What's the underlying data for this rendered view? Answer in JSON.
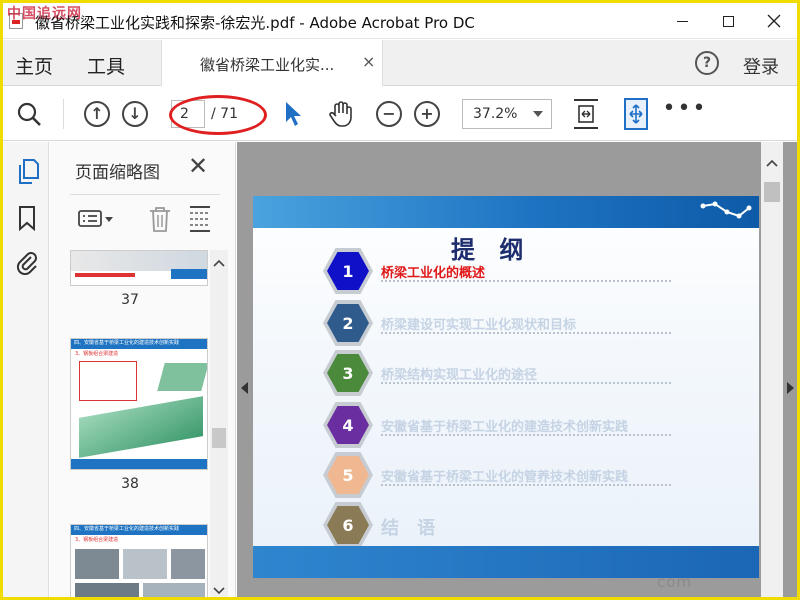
{
  "window": {
    "title": "徽省桥梁工业化实践和探索-徐宏光.pdf - Adobe Acrobat Pro DC",
    "watermark": "中国追远网"
  },
  "menubar": {
    "home": "主页",
    "tools": "工具",
    "tab_label": "徽省桥梁工业化实...",
    "tab_close": "×",
    "login": "登录"
  },
  "toolbar": {
    "current_page": "2",
    "total_pages": "/ 71",
    "zoom": "37.2%",
    "more": "•••"
  },
  "thumbnails": {
    "title": "页面缩略图",
    "close": "✕",
    "items": [
      {
        "page": "37"
      },
      {
        "page": "38",
        "heading": "四、安徽省基于桥梁工业化的建造技术创新实践",
        "sub": "3、钢板组合梁建造"
      },
      {
        "page": "",
        "heading": "四、安徽省基于桥梁工业化的建造技术创新实践",
        "sub": "3、钢板组合梁建造"
      }
    ]
  },
  "slide": {
    "title": "提 纲",
    "items": [
      {
        "num": "1",
        "text": "桥梁工业化的概述",
        "color": "#1010c8",
        "text_color": "#e01818"
      },
      {
        "num": "2",
        "text": "桥梁建设可实现工业化现状和目标",
        "color": "#2f5a8c",
        "text_color": "#c5d3e4"
      },
      {
        "num": "3",
        "text": "桥梁结构实现工业化的途径",
        "color": "#4a8a3a",
        "text_color": "#c5d3e4"
      },
      {
        "num": "4",
        "text": "安徽省基于桥梁工业化的建造技术创新实践",
        "color": "#6a2ea0",
        "text_color": "#c5d3e4"
      },
      {
        "num": "5",
        "text": "安徽省基于桥梁工业化的管养技术创新实践",
        "color": "#f0b890",
        "text_color": "#c5d3e4"
      },
      {
        "num": "6",
        "text": "结 语",
        "color": "#8a7a55",
        "text_color": "#c5d3e4"
      }
    ]
  },
  "corner_watermark": "com",
  "colors": {
    "accent_blue": "#1f6fc5",
    "frame_yellow": "#f0dc00",
    "annotation_red": "#e02020"
  }
}
